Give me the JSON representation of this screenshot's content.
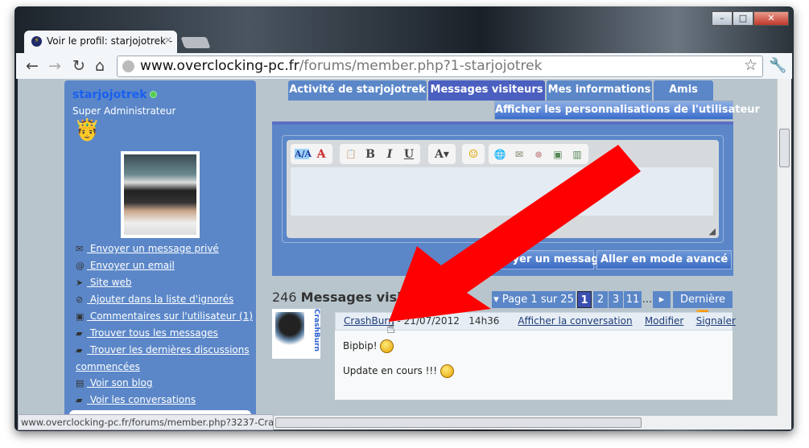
{
  "browser": {
    "tab_title": "Voir le profil: starjojotrek -",
    "url_host": "www.overclocking-pc.fr",
    "url_path": "/forums/member.php?1-starjojotrek",
    "status_url": "www.overclocking-pc.fr/forums/member.php?3237-Cras..."
  },
  "sidebar": {
    "username": "starjojotrek",
    "user_title": "Super Administrateur",
    "links": [
      {
        "icon": "envelope-icon",
        "glyph": "✉",
        "label": " Envoyer un message privé"
      },
      {
        "icon": "at-icon",
        "glyph": "@",
        "label": " Envoyer un email"
      },
      {
        "icon": "cursor-icon",
        "glyph": "➤",
        "label": " Site web"
      },
      {
        "icon": "block-icon",
        "glyph": "⊘",
        "label": " Ajouter dans la liste d'ignorés"
      },
      {
        "icon": "comment-icon",
        "glyph": "▣",
        "label": " Commentaires sur l'utilisateur (1)"
      },
      {
        "icon": "chat-icon",
        "glyph": "▰",
        "label": " Trouver tous les messages"
      },
      {
        "icon": "chat-icon",
        "glyph": "▰",
        "label": " Trouver les dernières discussions commencées"
      },
      {
        "icon": "blog-icon",
        "glyph": "▤",
        "label": " Voir son blog"
      },
      {
        "icon": "chat-icon",
        "glyph": "▰",
        "label": " Voir les conversations"
      }
    ]
  },
  "tabs": [
    "Activité de starjojotrek",
    "Messages visiteurs",
    "Mes informations",
    "Amis"
  ],
  "active_tab": "Messages visiteurs",
  "customize_button": "Afficher les personnalisations de l'utilisateur",
  "editor": {
    "toolbar": [
      "A/A",
      "A̶",
      "📋",
      "B",
      "I",
      "U",
      "A▾",
      "☺",
      "🌐",
      "✉",
      "⊗",
      "▣",
      "▥"
    ],
    "submit_button": "Envoyer un message",
    "advanced_button": "Aller en mode avancé"
  },
  "messages": {
    "count": "246",
    "title": "Messages visiteurs",
    "pagination": {
      "label": "Page 1 sur 25",
      "pages": [
        "1",
        "2",
        "3",
        "11"
      ],
      "ellipsis": "...",
      "last": "Dernière",
      "current": "1"
    },
    "items": [
      {
        "author": "CrashBurn",
        "avatar_text": "CrashBurn",
        "date": "- 21/07/2012",
        "time": "14h36",
        "actions": [
          "Afficher la conversation",
          "Modifier",
          "Signaler"
        ],
        "lines": [
          "Bipbip!",
          "Update en cours !!!"
        ]
      }
    ]
  },
  "colors": {
    "sidebar": "#5b87c8",
    "active_tab": "#4a5fc0",
    "arrow": "#ff0000",
    "page_bg": "#b8c5cd"
  }
}
